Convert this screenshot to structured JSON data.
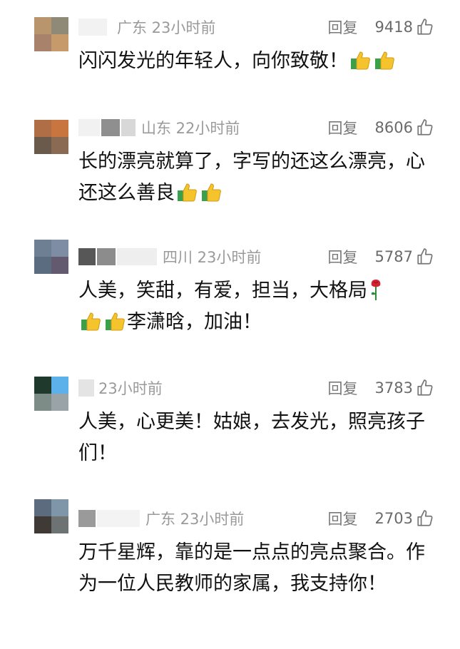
{
  "comments": [
    {
      "location_time": "广东 23小时前",
      "reply_label": "回复",
      "likes": "9418",
      "text": "闪闪发光的年轻人，向你致敬！",
      "emoji": [
        "thumbs-up",
        "thumbs-up"
      ],
      "avatar_colors": [
        "#b9956e",
        "#8f8a78",
        "#a8826a",
        "#c79a6b"
      ]
    },
    {
      "location_time": "山东 22小时前",
      "reply_label": "回复",
      "likes": "8606",
      "text": "长的漂亮就算了，字写的还这么漂亮，心还这么善良",
      "emoji": [
        "thumbs-up",
        "thumbs-up"
      ],
      "avatar_colors": [
        "#b06e47",
        "#c9753f",
        "#6a5a4c",
        "#8a6a52"
      ]
    },
    {
      "location_time": "四川 23小时前",
      "reply_label": "回复",
      "likes": "5787",
      "text_part1": "人美，笑甜，有爱，担当，大格局",
      "text_part2": "李潇晗，加油！",
      "emoji": [
        "rose",
        "thumbs-up",
        "thumbs-up"
      ],
      "avatar_colors": [
        "#6e7f93",
        "#7e8da4",
        "#5b6b80",
        "#635a6f"
      ]
    },
    {
      "location_time": "23小时前",
      "reply_label": "回复",
      "likes": "3783",
      "text": "人美，心更美！姑娘，去发光，照亮孩子们！",
      "emoji": [],
      "avatar_colors": [
        "#1f3a2c",
        "#5cb1ea",
        "#7e8c88",
        "#9aa3a8"
      ]
    },
    {
      "location_time": "广东 23小时前",
      "reply_label": "回复",
      "likes": "2703",
      "text": "万千星辉，靠的是一点点的亮点聚合。作为一位人民教师的家属，我支持你！",
      "emoji": [],
      "avatar_colors": [
        "#5c6b7e",
        "#7f95a8",
        "#3f3a36",
        "#6d7272"
      ]
    }
  ],
  "icons": {
    "like": "thumbs-up-outline-icon",
    "thumb_emoji_color": "#f5c42c",
    "thumb_emoji_cuff": "#3aa04a",
    "rose_color": "#d1242f"
  }
}
